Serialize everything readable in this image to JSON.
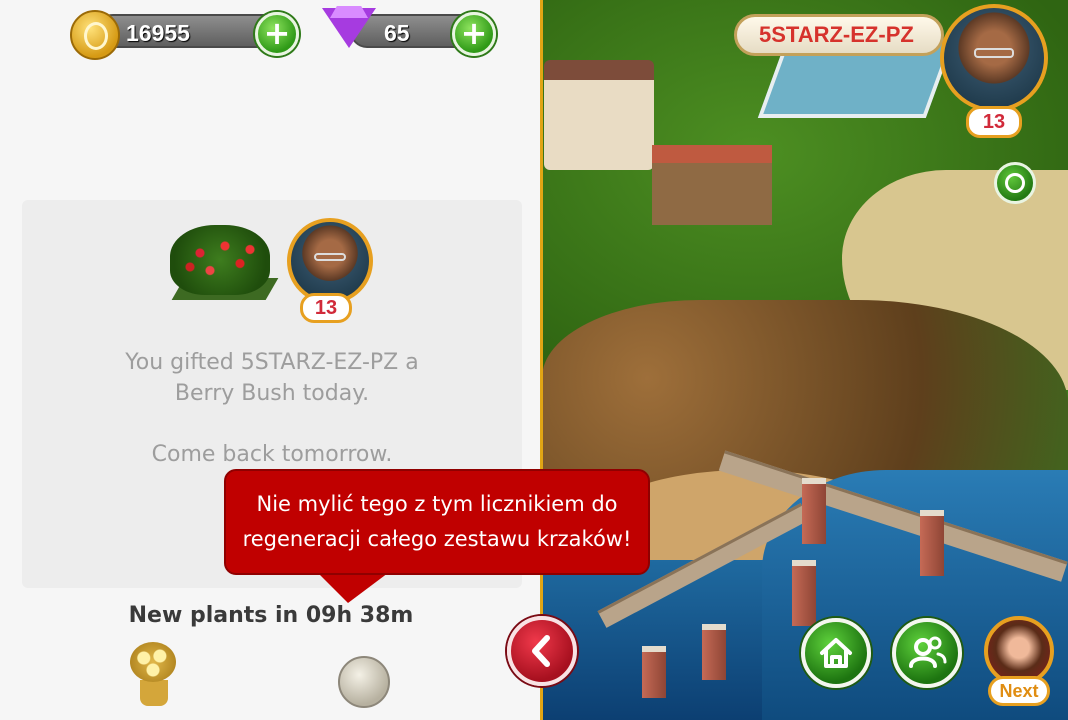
{
  "currency": {
    "coins": "16955",
    "gems": "65"
  },
  "gift_panel": {
    "message_line1": "You gifted 5STARZ-EZ-PZ a",
    "message_line2": "Berry Bush today.",
    "message_line3": "Come back tomorrow.",
    "friend_level": "13",
    "new_plants_timer": "New plants in 09h 38m"
  },
  "callout": {
    "line1": "Nie mylić tego z tym licznikiem do",
    "line2": "regeneracji całego zestawu krzaków!"
  },
  "neighbor": {
    "username": "5STARZ-EZ-PZ",
    "level": "13"
  },
  "nav": {
    "next_label": "Next"
  },
  "colors": {
    "accent_gold": "#e7a020",
    "callout_red": "#c00000",
    "button_green": "#2f9a17",
    "back_red": "#a7101f"
  },
  "icons": [
    "coin-icon",
    "gem-icon",
    "plus-icon",
    "berry-bush-icon",
    "bouquet-icon",
    "silver-coin-icon",
    "gear-icon",
    "home-icon",
    "friends-icon",
    "back-chevron-icon"
  ]
}
